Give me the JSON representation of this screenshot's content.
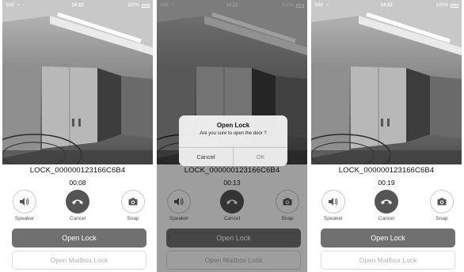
{
  "status_bar": {
    "carrier": "SIM",
    "time": "14:22",
    "battery": "100%"
  },
  "lock_name": "LOCK_000000123166C6B4",
  "controls": {
    "speaker": "Speaker",
    "cancel": "Cancel",
    "snap": "Snap"
  },
  "buttons": {
    "open_lock": "Open Lock",
    "open_mailbox": "Open Mailbox Lock"
  },
  "screens": [
    {
      "timer": "00:08"
    },
    {
      "timer": "00:13"
    },
    {
      "timer": "00:19"
    }
  ],
  "dialog": {
    "title": "Open Lock",
    "message": "Are you sure to open the door ?",
    "cancel": "Cancel",
    "ok": "OK"
  },
  "icons": {
    "speaker": "speaker-icon",
    "hangup": "phone-hangup-icon",
    "snap": "camera-icon",
    "wifi": "wifi-icon",
    "battery": "battery-icon"
  }
}
